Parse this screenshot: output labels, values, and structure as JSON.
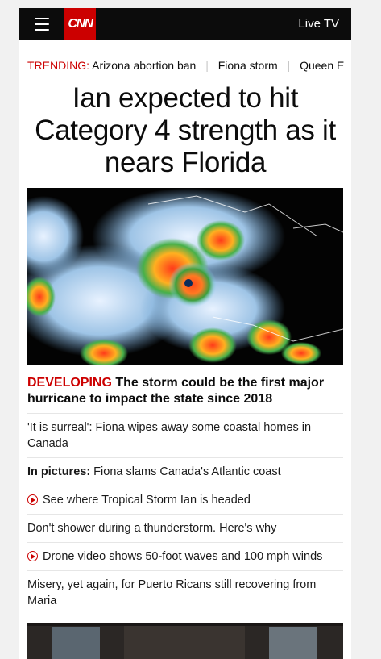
{
  "header": {
    "logo": "CNN",
    "live_tv": "Live TV",
    "menu_icon": "hamburger-menu-icon"
  },
  "trending": {
    "label": "TRENDING:",
    "items": [
      "Arizona abortion ban",
      "Fiona storm",
      "Queen E"
    ]
  },
  "headline": "Ian expected to hit Category 4 strength as it nears Florida",
  "lead": {
    "tag": "DEVELOPING",
    "text": " The storm could be the first major hurricane to impact the state since 2018"
  },
  "stories": [
    {
      "prefix": "",
      "text": "'It is surreal': Fiona wipes away some coastal homes in Canada",
      "video": false
    },
    {
      "prefix": "In pictures:",
      "text": " Fiona slams Canada's Atlantic coast",
      "video": false
    },
    {
      "prefix": "",
      "text": "See where Tropical Storm Ian is headed",
      "video": true
    },
    {
      "prefix": "",
      "text": "Don't shower during a thunderstorm. Here's why",
      "video": false
    },
    {
      "prefix": "",
      "text": "Drone video shows 50-foot waves and 100 mph winds",
      "video": true
    },
    {
      "prefix": "",
      "text": "Misery, yet again, for Puerto Ricans still recovering from Maria",
      "video": false
    }
  ],
  "colors": {
    "brand": "#cc0000",
    "topbar": "#0c0c0c"
  }
}
